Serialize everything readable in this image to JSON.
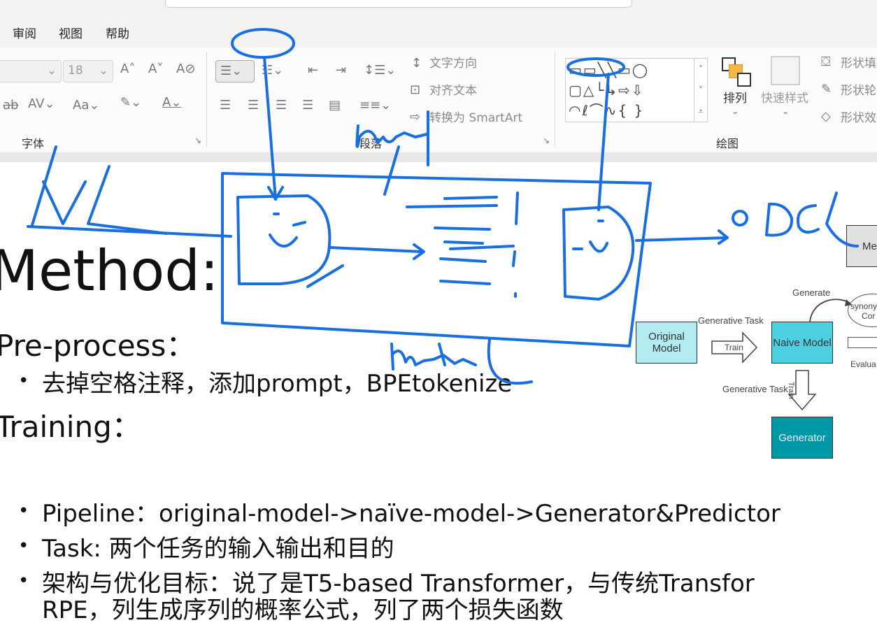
{
  "menu": {
    "review": "审阅",
    "view": "视图",
    "help": "帮助"
  },
  "ribbon": {
    "font_group_label": "字体",
    "paragraph_group_label": "段落",
    "drawing_group_label": "绘图",
    "font_size": "18",
    "text_direction": "文字方向",
    "align_text": "对齐文本",
    "convert_smartart": "转换为 SmartArt",
    "arrange": "排列",
    "quick_styles": "快速样式",
    "shape_fill": "形状填",
    "shape_outline": "形状轮",
    "shape_effects": "形状效"
  },
  "slide": {
    "title": "Method:",
    "preprocess_heading": "Pre-process：",
    "preprocess_bullet": "去掉空格注释，添加prompt，BPEtokenize",
    "training_heading": "Training：",
    "bullets": [
      "Pipeline：original-model->naïve-model->Generator&Predictor",
      "Task: 两个任务的输入输出和目的",
      "架构与优化目标：说了是T5-based Transformer，与传统Transfor",
      "RPE，列生成序列的概率公式，列了两个损失函数"
    ]
  },
  "diagram": {
    "original_model": "Original Model",
    "naive_model": "Naive Model",
    "generator": "Generator",
    "generative_task_1": "Generative Task",
    "generative_task_2": "Generative Task",
    "train_1": "Train",
    "train_2": "Train",
    "generate": "Generate",
    "evaluate_partial": "Evalua",
    "synonym_partial": "synony",
    "cor_partial": "Cor",
    "me_partial": "Me"
  },
  "ink": {
    "word_left": "LUL",
    "word_input": "input",
    "word_model": "model",
    "word_right": "OCL",
    "color": "#1a6fe0"
  },
  "colors": {
    "original_model_fill": "#b2ebf2",
    "naive_model_fill": "#4dd0e1",
    "generator_fill": "#0097a7"
  }
}
